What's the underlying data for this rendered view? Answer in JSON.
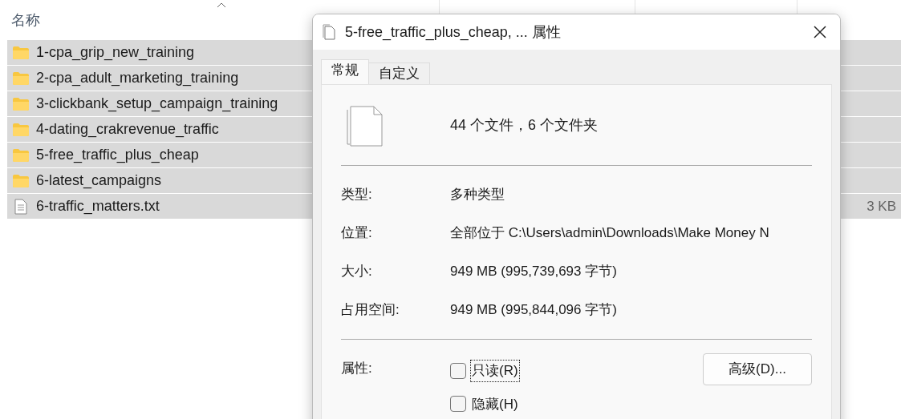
{
  "explorer": {
    "columns": [
      {
        "label": "名称",
        "sorted": true
      }
    ],
    "rows": [
      {
        "name": "1-cpa_grip_new_training",
        "kind": "folder",
        "selected": true
      },
      {
        "name": "2-cpa_adult_marketing_training",
        "kind": "folder",
        "selected": true
      },
      {
        "name": "3-clickbank_setup_campaign_training",
        "kind": "folder",
        "selected": true
      },
      {
        "name": "4-dating_crakrevenue_traffic",
        "kind": "folder",
        "selected": true
      },
      {
        "name": "5-free_traffic_plus_cheap",
        "kind": "folder",
        "selected": true
      },
      {
        "name": "6-latest_campaigns",
        "kind": "folder",
        "selected": true
      },
      {
        "name": "6-traffic_matters.txt",
        "kind": "file",
        "selected": true,
        "size": "3 KB"
      }
    ]
  },
  "dialog": {
    "title": "5-free_traffic_plus_cheap, ... 属性",
    "tabs": [
      {
        "label": "常规",
        "selected": true
      },
      {
        "label": "自定义",
        "selected": false
      }
    ],
    "summary": "44 个文件，6 个文件夹",
    "fields": [
      {
        "label": "类型:",
        "value": "多种类型"
      },
      {
        "label": "位置:",
        "value": "全部位于 C:\\Users\\admin\\Downloads\\Make Money N"
      },
      {
        "label": "大小:",
        "value": "949 MB (995,739,693 字节)"
      },
      {
        "label": "占用空间:",
        "value": "949 MB (995,844,096 字节)"
      }
    ],
    "attributes_label": "属性:",
    "attributes": [
      {
        "label": "只读(R)",
        "checked": false,
        "focused": true
      },
      {
        "label": "隐藏(H)",
        "checked": false,
        "focused": false
      }
    ],
    "advanced_button": "高级(D)..."
  }
}
